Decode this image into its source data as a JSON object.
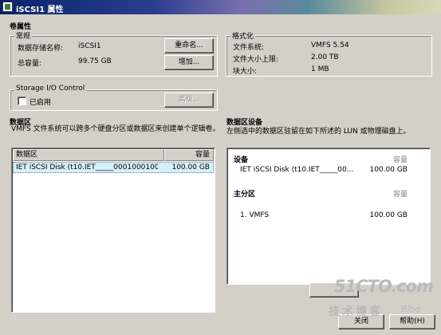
{
  "window": {
    "title": "iSCSI1 属性"
  },
  "volume": {
    "section_title": "卷属性",
    "general": {
      "label": "常规",
      "name_label": "数据存储名称:",
      "name_value": "iSCSI1",
      "capacity_label": "总容量:",
      "capacity_value": "99.75 GB",
      "rename_button": "重命名...",
      "increase_button": "增加..."
    },
    "format": {
      "label": "格式化",
      "fs_label": "文件系统:",
      "fs_value": "VMFS 5.54",
      "maxfile_label": "文件大小上限:",
      "maxfile_value": "2.00 TB",
      "block_label": "块大小:",
      "block_value": "1 MB"
    },
    "sioc": {
      "label": "Storage I/O Control",
      "enabled_label": "已启用",
      "enabled": false,
      "advanced_button": "高级..."
    }
  },
  "extents": {
    "title": "数据区",
    "description": "VMFS 文件系统可以跨多个硬盘分区或数据区来创建单个逻辑卷。",
    "col_extent": "数据区",
    "col_capacity": "容量",
    "rows": [
      {
        "name": "IET iSCSI Disk (t10.IET_____000100010000...",
        "capacity": "100.00 GB"
      }
    ]
  },
  "device": {
    "title": "数据区设备",
    "description": "左侧选中的数据区驻留在如下所述的 LUN 或物理磁盘上。",
    "device_label": "设备",
    "capacity_label": "容量",
    "device_name": "IET iSCSI Disk (t10.IET_____00...",
    "device_capacity": "100.00 GB",
    "partition_label": "主分区",
    "partition_capacity_label": "容量",
    "partition_name": "1. VMFS",
    "partition_capacity": "100.00 GB"
  },
  "footer": {
    "close_button": "关闭",
    "help_button": "帮助(H)"
  },
  "watermark": {
    "line1": "51CTO.com",
    "line2": "技术博客",
    "line3": "Blog"
  }
}
